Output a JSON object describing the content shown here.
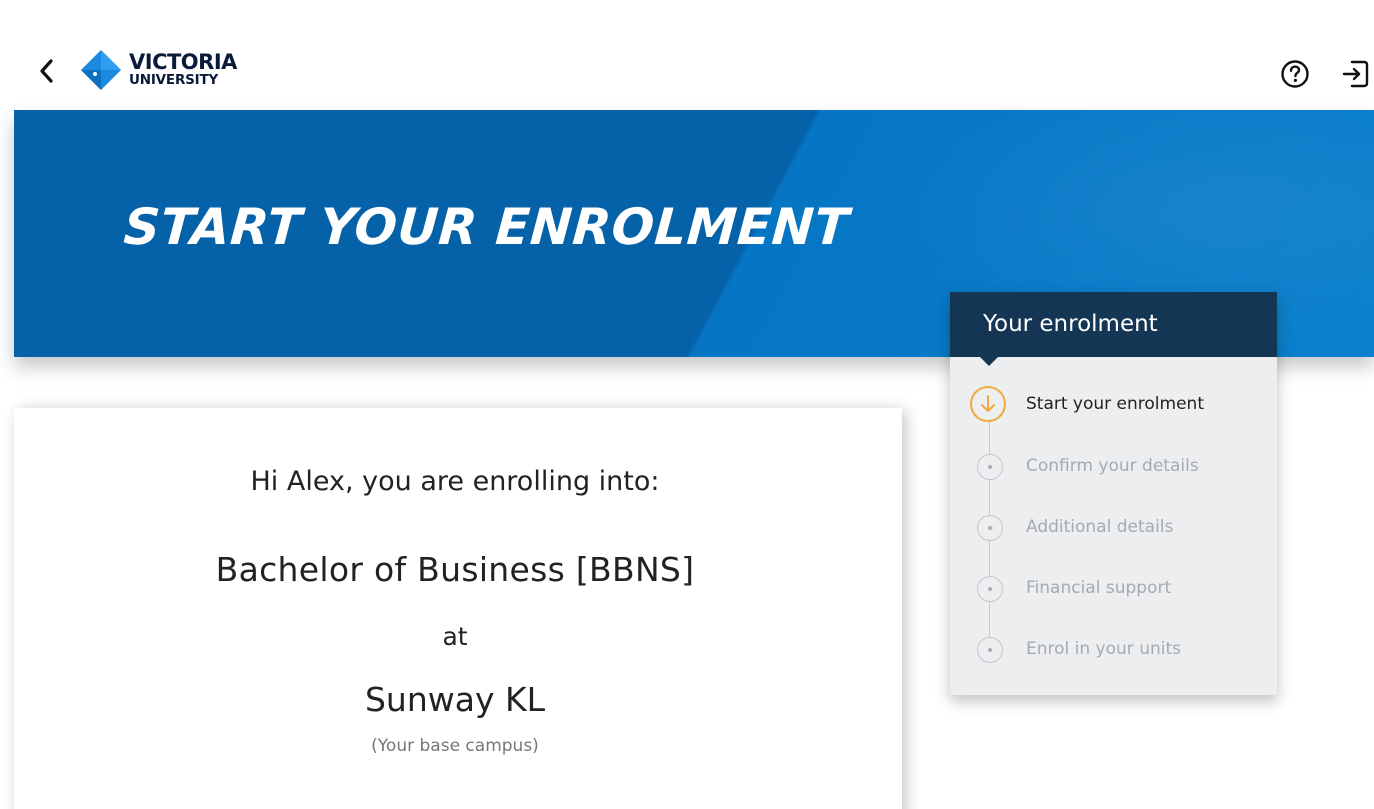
{
  "header": {
    "logo_line1": "VICTORIA",
    "logo_line2": "UNIVERSITY"
  },
  "banner": {
    "title": "START YOUR ENROLMENT"
  },
  "main": {
    "greeting": "Hi Alex, you are enrolling into:",
    "course": "Bachelor of Business [BBNS]",
    "at": "at",
    "campus": "Sunway KL",
    "campus_note": "(Your base campus)"
  },
  "side_panel": {
    "title": "Your enrolment",
    "steps": [
      {
        "label": "Start your enrolment",
        "state": "active"
      },
      {
        "label": "Confirm your details",
        "state": "pending"
      },
      {
        "label": "Additional details",
        "state": "pending"
      },
      {
        "label": "Financial support",
        "state": "pending"
      },
      {
        "label": "Enrol in your units",
        "state": "pending"
      }
    ]
  },
  "icons": {
    "back": "chevron-left-icon",
    "help": "question-circle-icon",
    "logout": "exit-icon",
    "active_step": "arrow-down-circle-icon"
  },
  "colors": {
    "banner_dark": "#0561a8",
    "banner_light": "#0a80cc",
    "panel_header": "#143554",
    "panel_bg": "#eceef0",
    "active_step": "#f2a93b"
  }
}
